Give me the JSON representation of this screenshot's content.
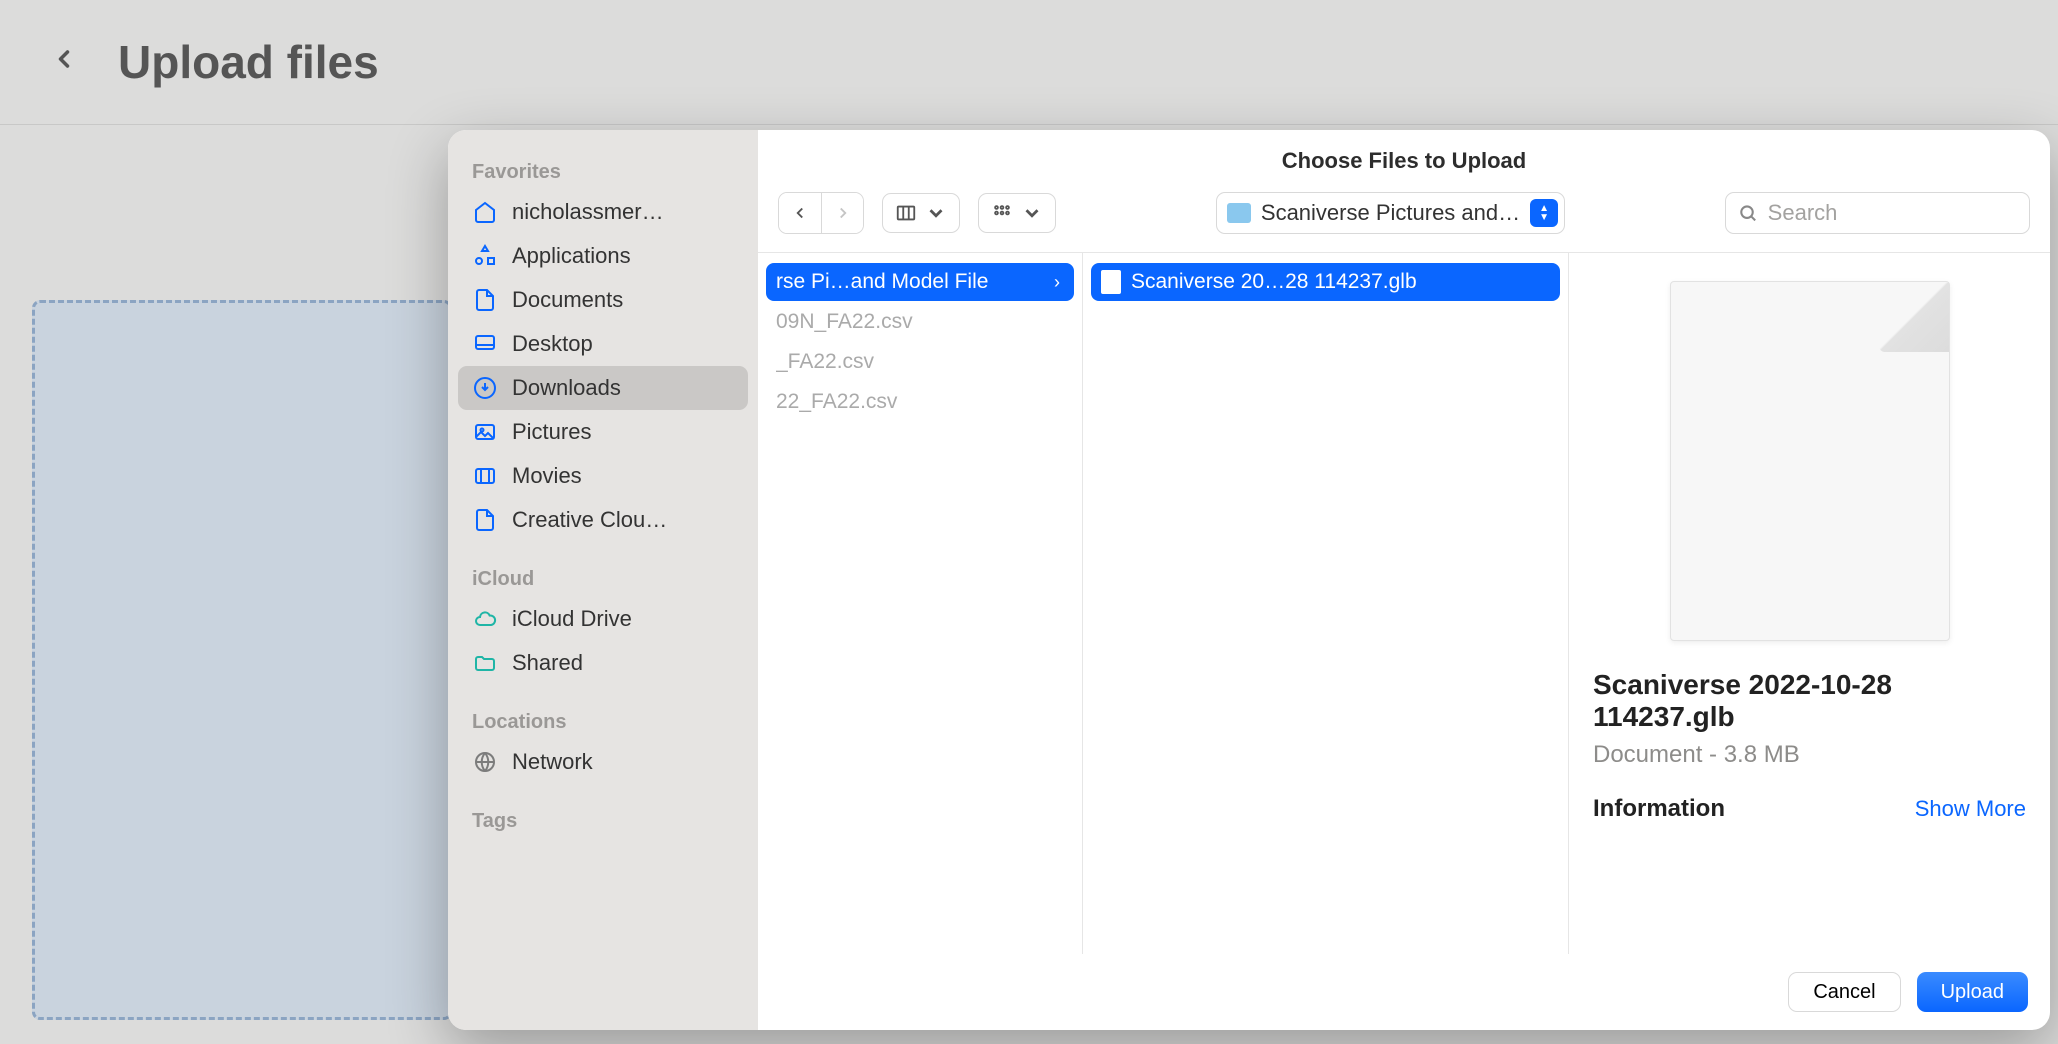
{
  "page": {
    "title": "Upload files"
  },
  "dialog": {
    "title": "Choose Files to Upload",
    "current_folder": "Scaniverse Pictures and…",
    "search_placeholder": "Search",
    "cancel": "Cancel",
    "upload": "Upload"
  },
  "sidebar": {
    "favorites_header": "Favorites",
    "icloud_header": "iCloud",
    "locations_header": "Locations",
    "tags_header": "Tags",
    "favorites": [
      {
        "label": "nicholassmer…",
        "icon": "home"
      },
      {
        "label": "Applications",
        "icon": "apps"
      },
      {
        "label": "Documents",
        "icon": "doc"
      },
      {
        "label": "Desktop",
        "icon": "desktop"
      },
      {
        "label": "Downloads",
        "icon": "download",
        "selected": true
      },
      {
        "label": "Pictures",
        "icon": "picture"
      },
      {
        "label": "Movies",
        "icon": "movie"
      },
      {
        "label": "Creative Clou…",
        "icon": "doc"
      }
    ],
    "icloud": [
      {
        "label": "iCloud Drive",
        "icon": "cloud"
      },
      {
        "label": "Shared",
        "icon": "shared"
      }
    ],
    "locations": [
      {
        "label": "Network",
        "icon": "network"
      }
    ]
  },
  "columns": {
    "col1": [
      {
        "label": "rse Pi…and Model File",
        "type": "folder",
        "selected": true
      },
      {
        "label": "09N_FA22.csv",
        "type": "file",
        "dimmed": true
      },
      {
        "label": "_FA22.csv",
        "type": "file",
        "dimmed": true
      },
      {
        "label": "22_FA22.csv",
        "type": "file",
        "dimmed": true
      }
    ],
    "col2": [
      {
        "label": "Scaniverse 20…28 114237.glb",
        "type": "file",
        "selected": true
      }
    ]
  },
  "preview": {
    "name": "Scaniverse 2022-10-28 114237.glb",
    "meta": "Document - 3.8 MB",
    "info_label": "Information",
    "show_more": "Show More"
  }
}
